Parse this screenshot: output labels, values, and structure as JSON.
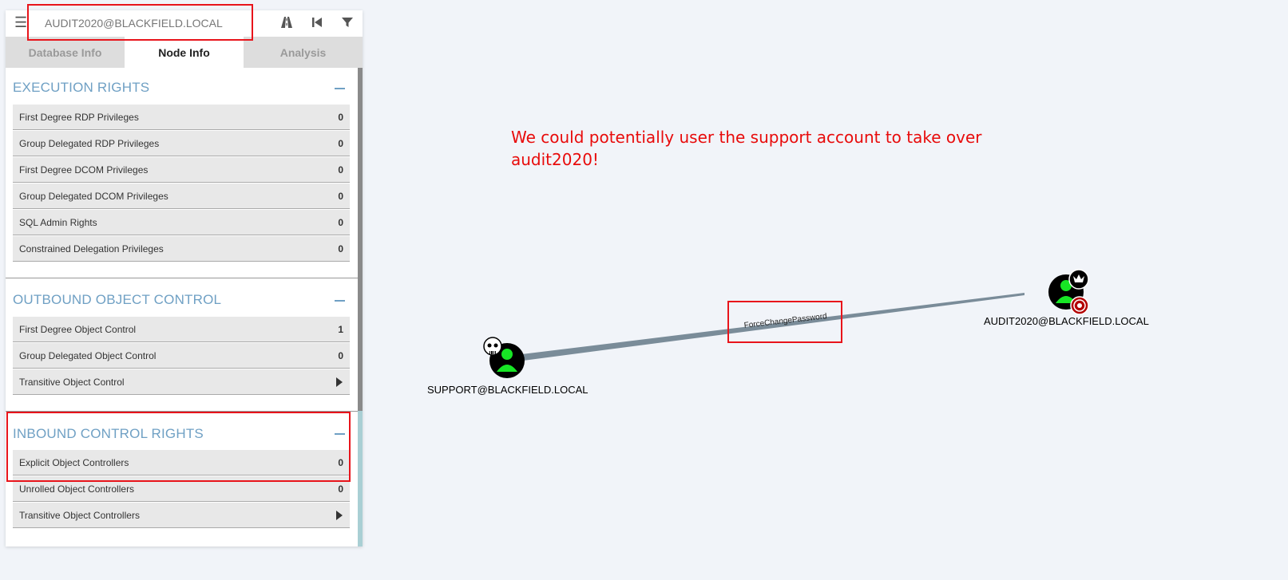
{
  "search": {
    "value": "AUDIT2020@BLACKFIELD.LOCAL"
  },
  "toolbar": {
    "menu_icon": "hamburger-icon",
    "pathfinding_icon": "road-icon",
    "back_icon": "skip-back-icon",
    "filter_icon": "filter-icon"
  },
  "tabs": [
    {
      "label": "Database Info"
    },
    {
      "label": "Node Info"
    },
    {
      "label": "Analysis"
    }
  ],
  "sections": {
    "execution": {
      "title": "EXECUTION RIGHTS",
      "rows": [
        {
          "label": "First Degree RDP Privileges",
          "value": "0"
        },
        {
          "label": "Group Delegated RDP Privileges",
          "value": "0"
        },
        {
          "label": "First Degree DCOM Privileges",
          "value": "0"
        },
        {
          "label": "Group Delegated DCOM Privileges",
          "value": "0"
        },
        {
          "label": "SQL Admin Rights",
          "value": "0"
        },
        {
          "label": "Constrained Delegation Privileges",
          "value": "0"
        }
      ]
    },
    "outbound": {
      "title": "OUTBOUND OBJECT CONTROL",
      "rows": [
        {
          "label": "First Degree Object Control",
          "value": "1"
        },
        {
          "label": "Group Delegated Object Control",
          "value": "0"
        },
        {
          "label": "Transitive Object Control",
          "value": ""
        }
      ]
    },
    "inbound": {
      "title": "INBOUND CONTROL RIGHTS",
      "rows": [
        {
          "label": "Explicit Object Controllers",
          "value": "0"
        },
        {
          "label": "Unrolled Object Controllers",
          "value": "0"
        },
        {
          "label": "Transitive Object Controllers",
          "value": ""
        }
      ]
    }
  },
  "graph": {
    "annotation": "We could potentially  user the support account to take over audit2020!",
    "edge_label": "ForceChangePassword",
    "source_node": {
      "label": "SUPPORT@BLACKFIELD.LOCAL",
      "icon": "user-icon",
      "badge": "skull-icon"
    },
    "target_node": {
      "label": "AUDIT2020@BLACKFIELD.LOCAL",
      "icon": "user-icon",
      "badges": [
        "crown-icon",
        "target-icon"
      ]
    },
    "colors": {
      "edge": "#7a8c99",
      "node_user": "#17e625",
      "highlight": "#e8141b",
      "annotation": "#e80b0b"
    }
  }
}
